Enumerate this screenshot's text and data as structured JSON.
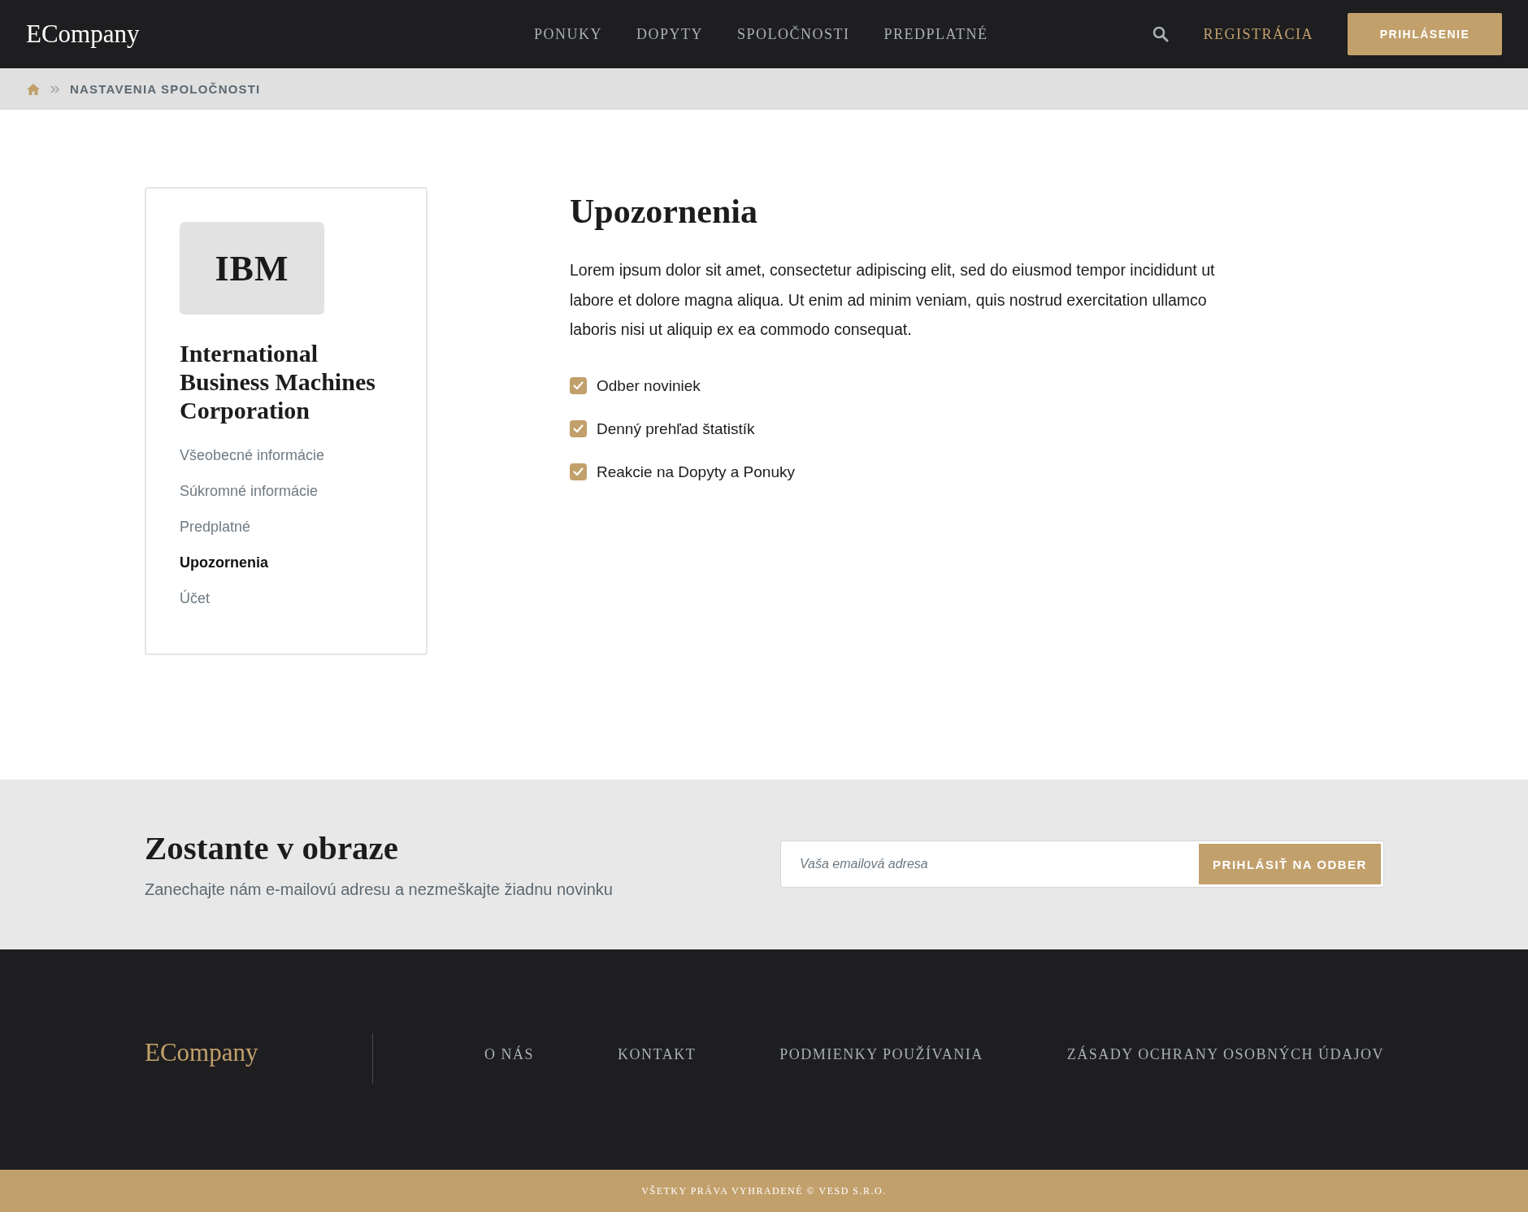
{
  "header": {
    "logo": "ECompany",
    "nav": [
      "PONUKY",
      "DOPYTY",
      "SPOLOČNOSTI",
      "PREDPLATNÉ"
    ],
    "register": "REGISTRÁCIA",
    "login": "PRIHLÁSENIE"
  },
  "breadcrumb": {
    "items": [
      "NASTAVENIA SPOLOČNOSTI"
    ]
  },
  "sidebar": {
    "logo": "IBM",
    "company": "International Business Machines Corporation",
    "items": [
      {
        "label": "Všeobecné informácie",
        "selected": false
      },
      {
        "label": "Súkromné informácie",
        "selected": false
      },
      {
        "label": "Predplatné",
        "selected": false
      },
      {
        "label": "Upozornenia",
        "selected": true
      },
      {
        "label": "Účet",
        "selected": false
      }
    ]
  },
  "content": {
    "title": "Upozornenia",
    "description": "Lorem ipsum dolor sit amet, consectetur adipiscing elit, sed do eiusmod tempor incididunt ut labore et dolore magna aliqua. Ut enim ad minim veniam, quis nostrud exercitation ullamco laboris nisi ut aliquip ex ea commodo consequat.",
    "options": [
      {
        "label": "Odber noviniek",
        "checked": true
      },
      {
        "label": "Denný prehľad štatistík",
        "checked": true
      },
      {
        "label": "Reakcie na Dopyty a Ponuky",
        "checked": true
      }
    ]
  },
  "newsletter": {
    "title": "Zostante v obraze",
    "subtitle": "Zanechajte nám e-mailovú adresu a nezmeškajte žiadnu novinku",
    "placeholder": "Vaša emailová adresa",
    "button": "PRIHLÁSIŤ NA ODBER"
  },
  "footer": {
    "logo": "ECompany",
    "links": [
      "O NÁS",
      "KONTAKT",
      "PODMIENKY POUŽÍVANIA",
      "ZÁSADY OCHRANY OSOBNÝCH ÚDAJOV"
    ],
    "copyright": "VŠETKY PRÁVA VYHRADENÉ © VESD S.R.O."
  }
}
